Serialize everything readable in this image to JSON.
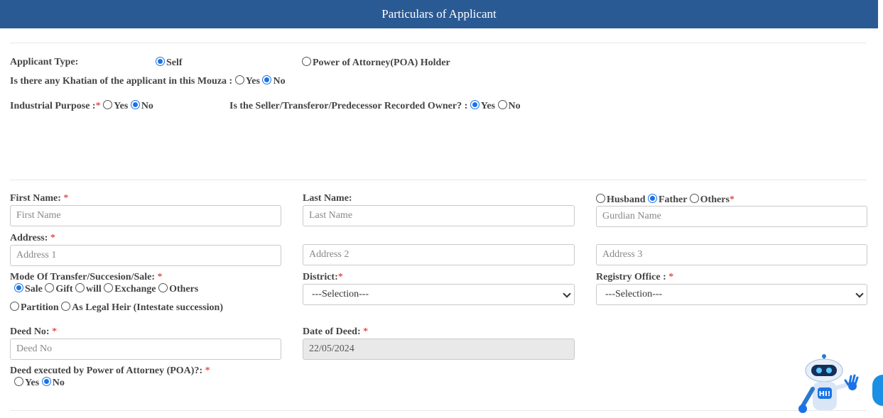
{
  "header": {
    "title": "Particulars of Applicant"
  },
  "applicant_type": {
    "label": "Applicant Type:",
    "options": [
      "Self",
      "Power of Attorney(POA) Holder"
    ],
    "selected": "Self"
  },
  "khatian": {
    "label": "Is there any Khatian of the applicant in this Mouza :",
    "options": [
      "Yes",
      "No"
    ],
    "selected": "No"
  },
  "industrial": {
    "label": "Industrial Purpose :",
    "req": "*",
    "options": [
      "Yes",
      "No"
    ],
    "selected": "No"
  },
  "seller_recorded": {
    "label": "Is the Seller/Transferor/Predecessor Recorded Owner? :",
    "options": [
      "Yes",
      "No"
    ],
    "selected": "Yes"
  },
  "first_name": {
    "label": "First Name:",
    "req": "*",
    "placeholder": "First Name"
  },
  "last_name": {
    "label": "Last Name:",
    "placeholder": "Last Name"
  },
  "guardian": {
    "options": [
      "Husband",
      "Father",
      "Others"
    ],
    "selected": "Father",
    "req": "*",
    "placeholder": "Gurdian Name"
  },
  "address": {
    "label": "Address:",
    "req": "*",
    "placeholders": [
      "Address 1",
      "Address 2",
      "Address 3"
    ]
  },
  "mode_transfer": {
    "label": "Mode Of Transfer/Succesion/Sale:",
    "req": "*",
    "options": [
      "Sale",
      "Gift",
      "will",
      "Exchange",
      "Others",
      "Partition",
      "As Legal Heir (Intestate succession)"
    ],
    "selected": "Sale"
  },
  "district": {
    "label": "District:",
    "req": "*",
    "value": "---Selection---"
  },
  "registry_office": {
    "label": "Registry Office :",
    "req": "*",
    "value": "---Selection---"
  },
  "deed_no": {
    "label": "Deed No:",
    "req": "*",
    "placeholder": "Deed No"
  },
  "date_of_deed": {
    "label": "Date of Deed:",
    "req": "*",
    "value": "22/05/2024"
  },
  "deed_poa": {
    "label": "Deed executed by Power of Attorney (POA)?:",
    "req": "*",
    "options": [
      "Yes",
      "No"
    ],
    "selected": "No"
  },
  "chatbot": {
    "badge": "HI!"
  }
}
